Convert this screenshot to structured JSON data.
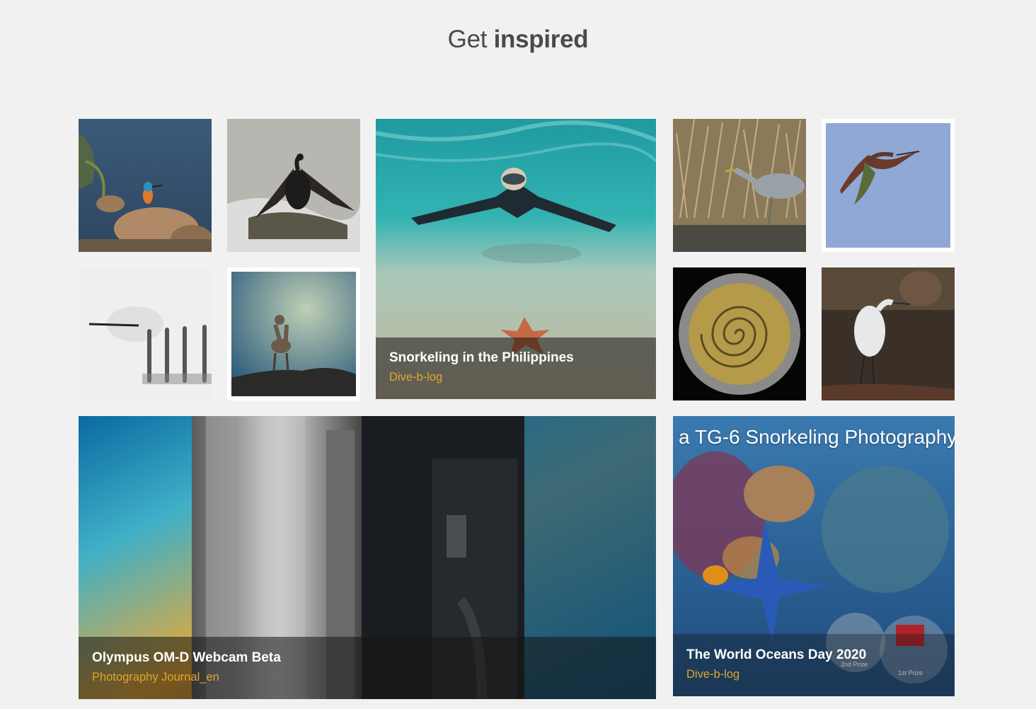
{
  "heading": {
    "light": "Get",
    "bold": "inspired"
  },
  "tiles": {
    "kingfisher": {
      "alt": "Kingfisher on rock"
    },
    "cormorant": {
      "alt": "Cormorant spreading wings"
    },
    "snorkeling": {
      "title": "Snorkeling in the Philippines",
      "source": "Dive-b-log"
    },
    "heron": {
      "alt": "Grey heron in reeds"
    },
    "ibis": {
      "alt": "Ibis in flight"
    },
    "forks": {
      "alt": "Forks in black and white"
    },
    "chamois": {
      "alt": "Chamois on rock"
    },
    "coin": {
      "alt": "Coin close-up"
    },
    "egret": {
      "alt": "Egret on branch"
    },
    "olympus": {
      "title": "Olympus OM-D Webcam Beta",
      "source": "Photography Journal_en"
    },
    "oceans": {
      "overlay": "a TG-6 Snorkeling Photography",
      "title": "The World Oceans Day 2020",
      "source": "Dive-b-log",
      "prize2": "2nd Prize",
      "prize1": "1st Prize"
    }
  },
  "colors": {
    "accent": "#e0a72a",
    "background": "#f1f1f1"
  }
}
